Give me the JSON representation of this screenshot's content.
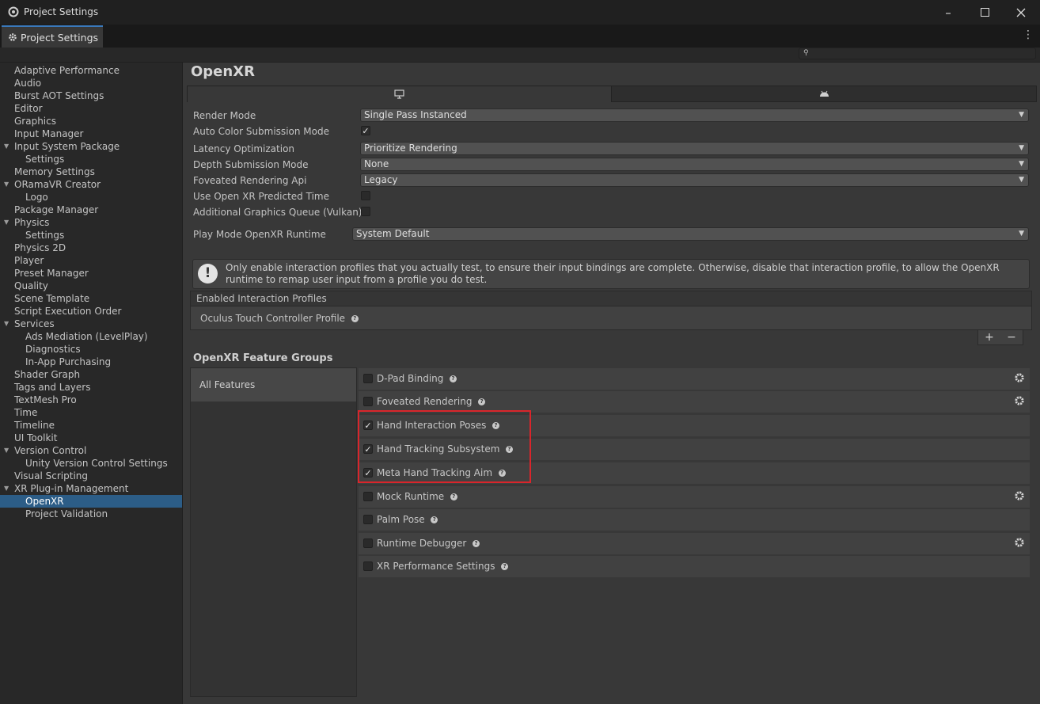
{
  "window": {
    "title": "Project Settings",
    "tab_label": "Project Settings"
  },
  "search": {
    "placeholder": ""
  },
  "sidebar": {
    "items": [
      {
        "label": "Adaptive Performance"
      },
      {
        "label": "Audio"
      },
      {
        "label": "Burst AOT Settings"
      },
      {
        "label": "Editor"
      },
      {
        "label": "Graphics"
      },
      {
        "label": "Input Manager"
      },
      {
        "label": "Input System Package",
        "expanded": true
      },
      {
        "label": "Settings",
        "child": true
      },
      {
        "label": "Memory Settings"
      },
      {
        "label": "ORamaVR Creator",
        "expanded": true
      },
      {
        "label": "Logo",
        "child": true
      },
      {
        "label": "Package Manager"
      },
      {
        "label": "Physics",
        "expanded": true
      },
      {
        "label": "Settings",
        "child": true
      },
      {
        "label": "Physics 2D"
      },
      {
        "label": "Player"
      },
      {
        "label": "Preset Manager"
      },
      {
        "label": "Quality"
      },
      {
        "label": "Scene Template"
      },
      {
        "label": "Script Execution Order"
      },
      {
        "label": "Services",
        "expanded": true
      },
      {
        "label": "Ads Mediation (LevelPlay)",
        "child": true
      },
      {
        "label": "Diagnostics",
        "child": true
      },
      {
        "label": "In-App Purchasing",
        "child": true
      },
      {
        "label": "Shader Graph"
      },
      {
        "label": "Tags and Layers"
      },
      {
        "label": "TextMesh Pro"
      },
      {
        "label": "Time"
      },
      {
        "label": "Timeline"
      },
      {
        "label": "UI Toolkit"
      },
      {
        "label": "Version Control",
        "expanded": true
      },
      {
        "label": "Unity Version Control Settings",
        "child": true
      },
      {
        "label": "Visual Scripting"
      },
      {
        "label": "XR Plug-in Management",
        "expanded": true
      },
      {
        "label": "OpenXR",
        "child": true,
        "selected": true
      },
      {
        "label": "Project Validation",
        "child": true
      }
    ]
  },
  "main": {
    "title": "OpenXR",
    "platform_tabs": [
      {
        "icon": "monitor-icon",
        "active": true
      },
      {
        "icon": "android-icon",
        "active": false
      }
    ],
    "settings": {
      "render_mode": {
        "label": "Render Mode",
        "value": "Single Pass Instanced"
      },
      "auto_color": {
        "label": "Auto Color Submission Mode",
        "checked": true
      },
      "latency": {
        "label": "Latency Optimization",
        "value": "Prioritize Rendering"
      },
      "depth": {
        "label": "Depth Submission Mode",
        "value": "None"
      },
      "foveated_api": {
        "label": "Foveated Rendering Api",
        "value": "Legacy"
      },
      "predicted_time": {
        "label": "Use Open XR Predicted Time",
        "checked": false
      },
      "graphics_queue": {
        "label": "Additional Graphics Queue (Vulkan)",
        "checked": false
      },
      "runtime": {
        "label": "Play Mode OpenXR Runtime",
        "value": "System Default"
      }
    },
    "help_message": "Only enable interaction profiles that you actually test, to ensure their input bindings are complete. Otherwise, disable that interaction profile, to allow the OpenXR runtime to remap user input from a profile you do test.",
    "profiles": {
      "header": "Enabled Interaction Profiles",
      "items": [
        "Oculus Touch Controller Profile"
      ],
      "add_label": "+",
      "remove_label": "−"
    },
    "feature_groups": {
      "title": "OpenXR Feature Groups",
      "groups": [
        "All Features"
      ],
      "features": [
        {
          "name": "D-Pad Binding",
          "checked": false,
          "gear": true
        },
        {
          "name": "Foveated Rendering",
          "checked": false,
          "gear": true
        },
        {
          "name": "Hand Interaction Poses",
          "checked": true,
          "gear": false
        },
        {
          "name": "Hand Tracking Subsystem",
          "checked": true,
          "gear": false
        },
        {
          "name": "Meta Hand Tracking Aim",
          "checked": true,
          "gear": false
        },
        {
          "name": "Mock Runtime",
          "checked": false,
          "gear": true
        },
        {
          "name": "Palm Pose",
          "checked": false,
          "gear": false
        },
        {
          "name": "Runtime Debugger",
          "checked": false,
          "gear": true
        },
        {
          "name": "XR Performance Settings",
          "checked": false,
          "gear": false
        }
      ]
    }
  },
  "colors": {
    "selection": "#2c5d87",
    "highlight": "#d9252b",
    "tab_accent": "#3a79bb"
  }
}
